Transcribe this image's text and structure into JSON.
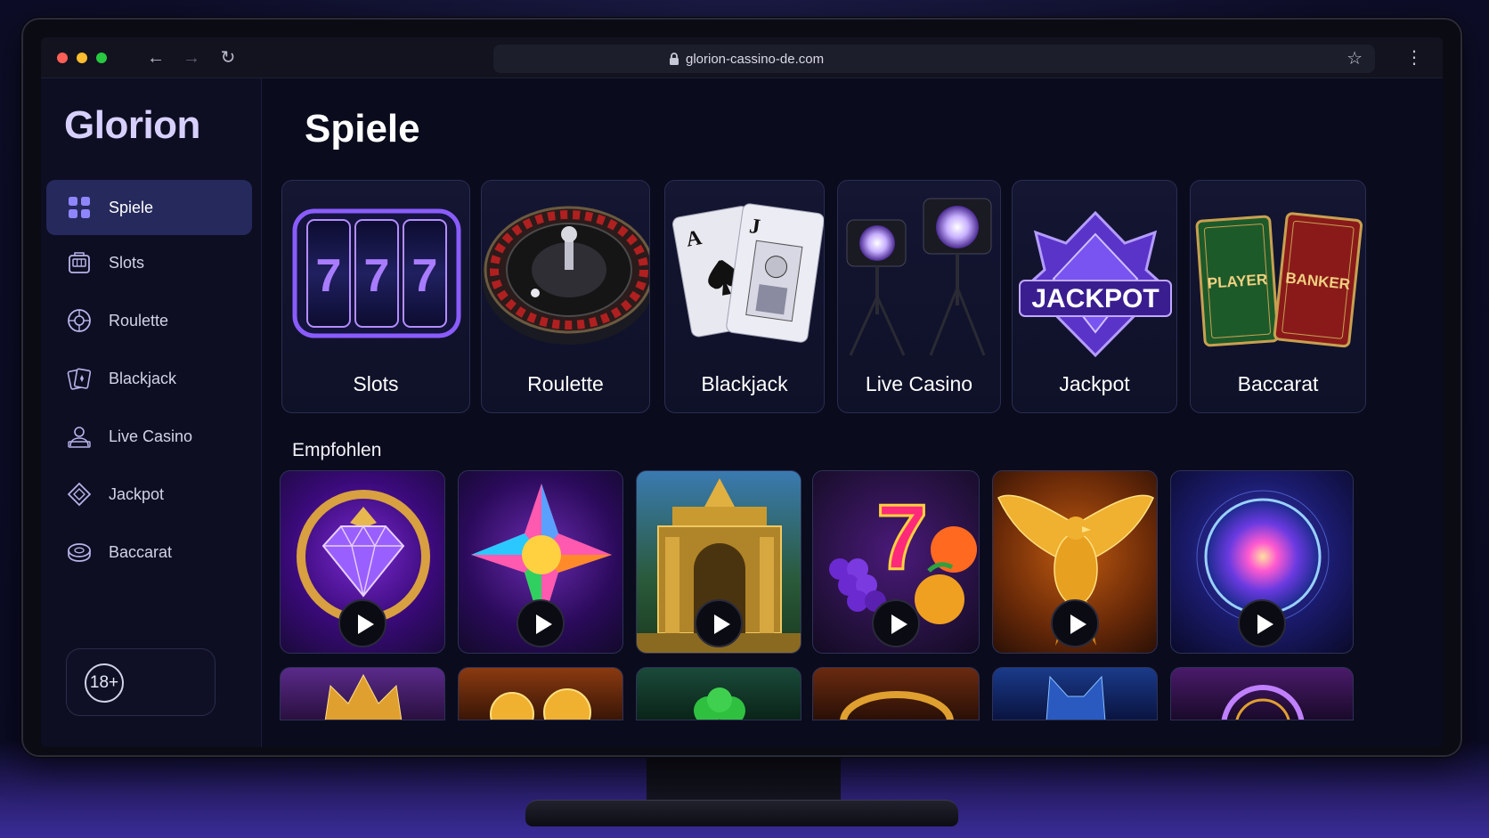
{
  "browser": {
    "url": "glorion-cassino-de.com"
  },
  "sidebar": {
    "logo": "Glorion",
    "items": [
      {
        "label": "Spiele",
        "icon": "grid-icon",
        "active": true
      },
      {
        "label": "Slots",
        "icon": "slot-machine-icon",
        "active": false
      },
      {
        "label": "Roulette",
        "icon": "roulette-icon",
        "active": false
      },
      {
        "label": "Blackjack",
        "icon": "cards-icon",
        "active": false
      },
      {
        "label": "Live Casino",
        "icon": "dealer-icon",
        "active": false
      },
      {
        "label": "Jackpot",
        "icon": "diamond-icon",
        "active": false
      },
      {
        "label": "Baccarat",
        "icon": "chip-icon",
        "active": false
      }
    ],
    "age_badge": "18+"
  },
  "main": {
    "title": "Spiele",
    "categories": [
      {
        "label": "Slots",
        "art": "slot-reels-777"
      },
      {
        "label": "Roulette",
        "art": "roulette-wheel"
      },
      {
        "label": "Blackjack",
        "art": "ace-jack-cards"
      },
      {
        "label": "Live Casino",
        "art": "studio-spotlights"
      },
      {
        "label": "Jackpot",
        "art": "jackpot-crown-gem"
      },
      {
        "label": "Baccarat",
        "art": "player-banker-cards"
      }
    ],
    "jackpot_art_text": "JACKPOT",
    "baccarat_player_text": "PLAYER",
    "baccarat_banker_text": "BANKER",
    "section_recommended": "Empfohlen",
    "recommended_games": [
      {
        "art": "purple-diamond-frame"
      },
      {
        "art": "rainbow-star-gem"
      },
      {
        "art": "golden-temple"
      },
      {
        "art": "fruits-seven"
      },
      {
        "art": "golden-phoenix"
      },
      {
        "art": "cosmic-orb"
      }
    ],
    "more_games": [
      {
        "art": "gold-crown"
      },
      {
        "art": "gold-coins"
      },
      {
        "art": "clover"
      },
      {
        "art": "golden-ring"
      },
      {
        "art": "blue-wolf"
      },
      {
        "art": "purple-wheel"
      }
    ]
  },
  "colors": {
    "accent": "#26295c",
    "background": "#0a0b1c",
    "logo": "#d7d0ff"
  }
}
